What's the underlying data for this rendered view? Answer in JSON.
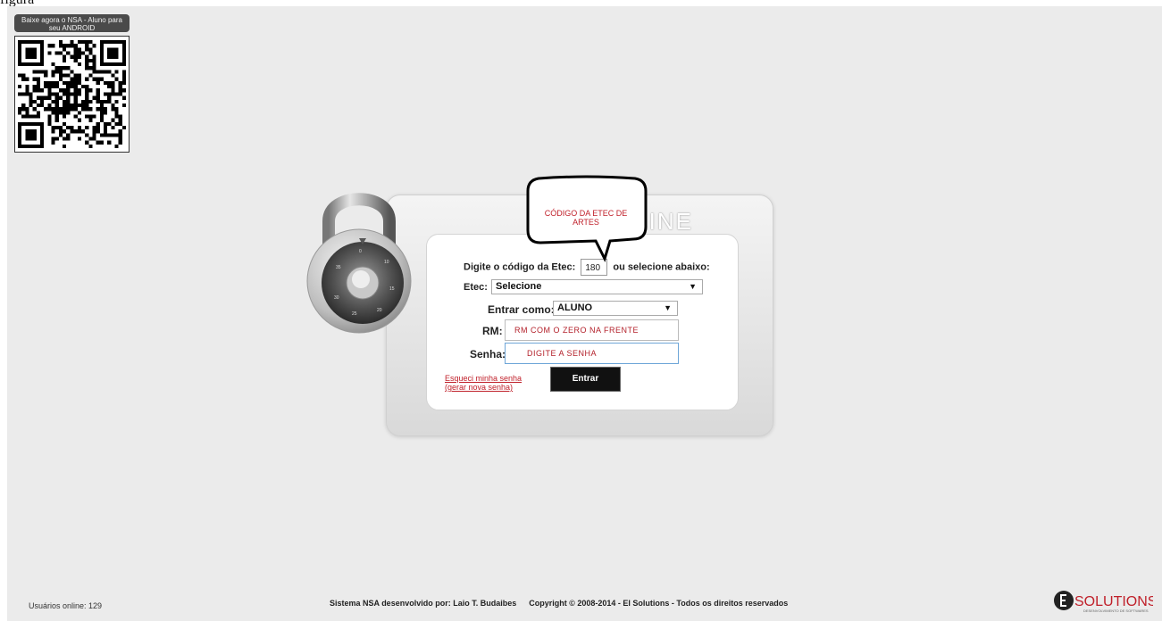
{
  "top_caption": "figura",
  "android": {
    "banner_text": "Baixe agora o NSA - Aluno para seu ANDROID",
    "qr_icon": "qr-code-icon"
  },
  "login": {
    "title": "NSA ONLINE",
    "code_label": "Digite o código da Etec:",
    "code_value": "180",
    "code_suffix": "ou selecione abaixo:",
    "etec_label": "Etec:",
    "etec_selected": "Selecione",
    "role_label": "Entrar como:",
    "role_selected": "ALUNO",
    "rm_label": "RM:",
    "rm_value": "RM COM O ZERO NA FRENTE",
    "password_label": "Senha:",
    "password_value": "DIGITE A SENHA",
    "forgot_line1": "Esqueci minha senha",
    "forgot_line2": "(gerar nova senha)",
    "submit_label": "Entrar",
    "lock_icon": "padlock-icon"
  },
  "bubble": {
    "text": "CÓDIGO DA ETEC DE ARTES"
  },
  "footer": {
    "users_online": "Usuários online:  129",
    "developed_by": "Sistema NSA desenvolvido por: Laio T. Budaibes",
    "copyright": "Copyright © 2008-2014 - El Solutions - Todos os direitos reservados",
    "logo_text": "SOLUTIONS",
    "logo_subtext": "DESENVOLVIMENTO DE SOFTWARES"
  },
  "colors": {
    "accent_red": "#c0202a",
    "background": "#ebebeb"
  }
}
